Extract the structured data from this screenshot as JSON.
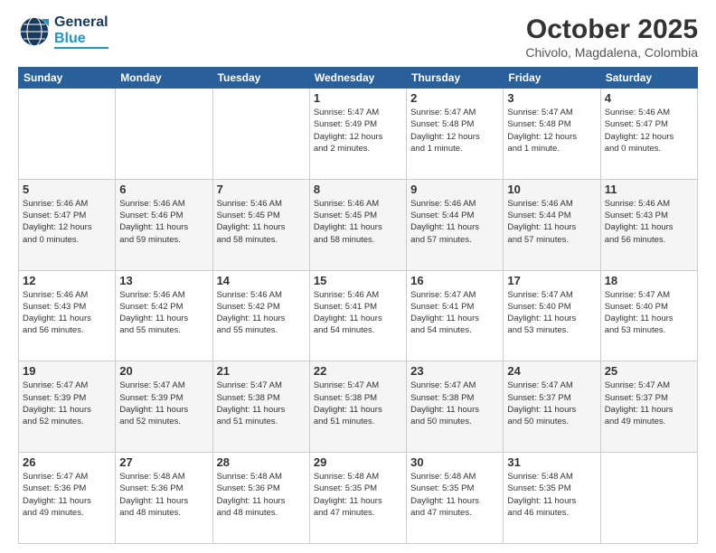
{
  "logo": {
    "line1": "General",
    "line2": "Blue"
  },
  "title": "October 2025",
  "location": "Chivolo, Magdalena, Colombia",
  "weekdays": [
    "Sunday",
    "Monday",
    "Tuesday",
    "Wednesday",
    "Thursday",
    "Friday",
    "Saturday"
  ],
  "weeks": [
    {
      "days": [
        {
          "num": "",
          "info": ""
        },
        {
          "num": "",
          "info": ""
        },
        {
          "num": "",
          "info": ""
        },
        {
          "num": "1",
          "info": "Sunrise: 5:47 AM\nSunset: 5:49 PM\nDaylight: 12 hours\nand 2 minutes."
        },
        {
          "num": "2",
          "info": "Sunrise: 5:47 AM\nSunset: 5:48 PM\nDaylight: 12 hours\nand 1 minute."
        },
        {
          "num": "3",
          "info": "Sunrise: 5:47 AM\nSunset: 5:48 PM\nDaylight: 12 hours\nand 1 minute."
        },
        {
          "num": "4",
          "info": "Sunrise: 5:46 AM\nSunset: 5:47 PM\nDaylight: 12 hours\nand 0 minutes."
        }
      ]
    },
    {
      "days": [
        {
          "num": "5",
          "info": "Sunrise: 5:46 AM\nSunset: 5:47 PM\nDaylight: 12 hours\nand 0 minutes."
        },
        {
          "num": "6",
          "info": "Sunrise: 5:46 AM\nSunset: 5:46 PM\nDaylight: 11 hours\nand 59 minutes."
        },
        {
          "num": "7",
          "info": "Sunrise: 5:46 AM\nSunset: 5:45 PM\nDaylight: 11 hours\nand 58 minutes."
        },
        {
          "num": "8",
          "info": "Sunrise: 5:46 AM\nSunset: 5:45 PM\nDaylight: 11 hours\nand 58 minutes."
        },
        {
          "num": "9",
          "info": "Sunrise: 5:46 AM\nSunset: 5:44 PM\nDaylight: 11 hours\nand 57 minutes."
        },
        {
          "num": "10",
          "info": "Sunrise: 5:46 AM\nSunset: 5:44 PM\nDaylight: 11 hours\nand 57 minutes."
        },
        {
          "num": "11",
          "info": "Sunrise: 5:46 AM\nSunset: 5:43 PM\nDaylight: 11 hours\nand 56 minutes."
        }
      ]
    },
    {
      "days": [
        {
          "num": "12",
          "info": "Sunrise: 5:46 AM\nSunset: 5:43 PM\nDaylight: 11 hours\nand 56 minutes."
        },
        {
          "num": "13",
          "info": "Sunrise: 5:46 AM\nSunset: 5:42 PM\nDaylight: 11 hours\nand 55 minutes."
        },
        {
          "num": "14",
          "info": "Sunrise: 5:46 AM\nSunset: 5:42 PM\nDaylight: 11 hours\nand 55 minutes."
        },
        {
          "num": "15",
          "info": "Sunrise: 5:46 AM\nSunset: 5:41 PM\nDaylight: 11 hours\nand 54 minutes."
        },
        {
          "num": "16",
          "info": "Sunrise: 5:47 AM\nSunset: 5:41 PM\nDaylight: 11 hours\nand 54 minutes."
        },
        {
          "num": "17",
          "info": "Sunrise: 5:47 AM\nSunset: 5:40 PM\nDaylight: 11 hours\nand 53 minutes."
        },
        {
          "num": "18",
          "info": "Sunrise: 5:47 AM\nSunset: 5:40 PM\nDaylight: 11 hours\nand 53 minutes."
        }
      ]
    },
    {
      "days": [
        {
          "num": "19",
          "info": "Sunrise: 5:47 AM\nSunset: 5:39 PM\nDaylight: 11 hours\nand 52 minutes."
        },
        {
          "num": "20",
          "info": "Sunrise: 5:47 AM\nSunset: 5:39 PM\nDaylight: 11 hours\nand 52 minutes."
        },
        {
          "num": "21",
          "info": "Sunrise: 5:47 AM\nSunset: 5:38 PM\nDaylight: 11 hours\nand 51 minutes."
        },
        {
          "num": "22",
          "info": "Sunrise: 5:47 AM\nSunset: 5:38 PM\nDaylight: 11 hours\nand 51 minutes."
        },
        {
          "num": "23",
          "info": "Sunrise: 5:47 AM\nSunset: 5:38 PM\nDaylight: 11 hours\nand 50 minutes."
        },
        {
          "num": "24",
          "info": "Sunrise: 5:47 AM\nSunset: 5:37 PM\nDaylight: 11 hours\nand 50 minutes."
        },
        {
          "num": "25",
          "info": "Sunrise: 5:47 AM\nSunset: 5:37 PM\nDaylight: 11 hours\nand 49 minutes."
        }
      ]
    },
    {
      "days": [
        {
          "num": "26",
          "info": "Sunrise: 5:47 AM\nSunset: 5:36 PM\nDaylight: 11 hours\nand 49 minutes."
        },
        {
          "num": "27",
          "info": "Sunrise: 5:48 AM\nSunset: 5:36 PM\nDaylight: 11 hours\nand 48 minutes."
        },
        {
          "num": "28",
          "info": "Sunrise: 5:48 AM\nSunset: 5:36 PM\nDaylight: 11 hours\nand 48 minutes."
        },
        {
          "num": "29",
          "info": "Sunrise: 5:48 AM\nSunset: 5:35 PM\nDaylight: 11 hours\nand 47 minutes."
        },
        {
          "num": "30",
          "info": "Sunrise: 5:48 AM\nSunset: 5:35 PM\nDaylight: 11 hours\nand 47 minutes."
        },
        {
          "num": "31",
          "info": "Sunrise: 5:48 AM\nSunset: 5:35 PM\nDaylight: 11 hours\nand 46 minutes."
        },
        {
          "num": "",
          "info": ""
        }
      ]
    }
  ]
}
